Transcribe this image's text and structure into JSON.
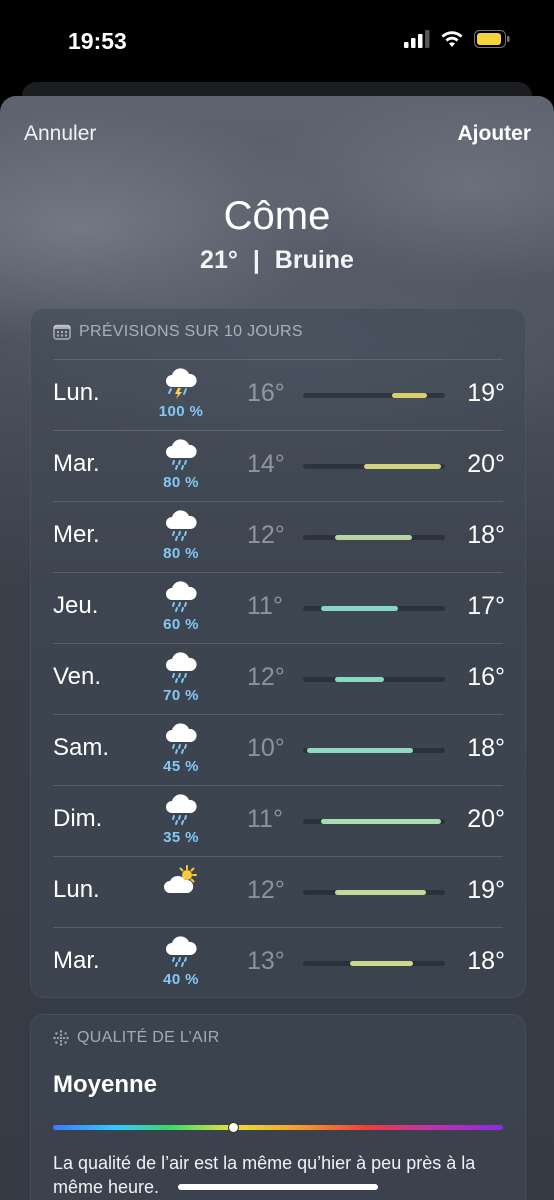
{
  "status_bar": {
    "time": "19:53"
  },
  "nav": {
    "cancel": "Annuler",
    "add": "Ajouter"
  },
  "location": {
    "city": "Côme",
    "temperature": "21°",
    "separator": "|",
    "condition": "Bruine"
  },
  "forecast": {
    "header": "PRÉVISIONS SUR 10 JOURS",
    "range_min": 10,
    "range_max": 20,
    "days": [
      {
        "day": "Lun.",
        "icon": "thunderstorm-icon",
        "precip": "100 %",
        "low": "16°",
        "high": "19°",
        "low_val": 16,
        "high_val": 19,
        "color": "#d9cf6a"
      },
      {
        "day": "Mar.",
        "icon": "rain-cloud-icon",
        "precip": "80 %",
        "low": "14°",
        "high": "20°",
        "low_val": 14,
        "high_val": 20,
        "color": "#d3d27a"
      },
      {
        "day": "Mer.",
        "icon": "rain-cloud-icon",
        "precip": "80 %",
        "low": "12°",
        "high": "18°",
        "low_val": 12,
        "high_val": 18,
        "color": "#b5d6a2"
      },
      {
        "day": "Jeu.",
        "icon": "rain-cloud-icon",
        "precip": "60 %",
        "low": "11°",
        "high": "17°",
        "low_val": 11,
        "high_val": 17,
        "color": "#86d6c4"
      },
      {
        "day": "Ven.",
        "icon": "rain-cloud-icon",
        "precip": "70 %",
        "low": "12°",
        "high": "16°",
        "low_val": 12,
        "high_val": 16,
        "color": "#8ad8c0"
      },
      {
        "day": "Sam.",
        "icon": "rain-cloud-icon",
        "precip": "45 %",
        "low": "10°",
        "high": "18°",
        "low_val": 10,
        "high_val": 18,
        "color": "#8fdac0"
      },
      {
        "day": "Dim.",
        "icon": "rain-cloud-icon",
        "precip": "35 %",
        "low": "11°",
        "high": "20°",
        "low_val": 11,
        "high_val": 20,
        "color": "#a9dcb0"
      },
      {
        "day": "Lun.",
        "icon": "partly-sunny-icon",
        "precip": "",
        "low": "12°",
        "high": "19°",
        "low_val": 12,
        "high_val": 19,
        "color": "#c3d89a"
      },
      {
        "day": "Mar.",
        "icon": "rain-cloud-icon",
        "precip": "40 %",
        "low": "13°",
        "high": "18°",
        "low_val": 13,
        "high_val": 18,
        "color": "#cbd88e"
      }
    ]
  },
  "air_quality": {
    "header": "QUALITÉ DE L’AIR",
    "level": "Moyenne",
    "indicator_fraction": 0.4,
    "description": "La qualité de l’air est la même qu’hier à peu près à la même heure."
  }
}
